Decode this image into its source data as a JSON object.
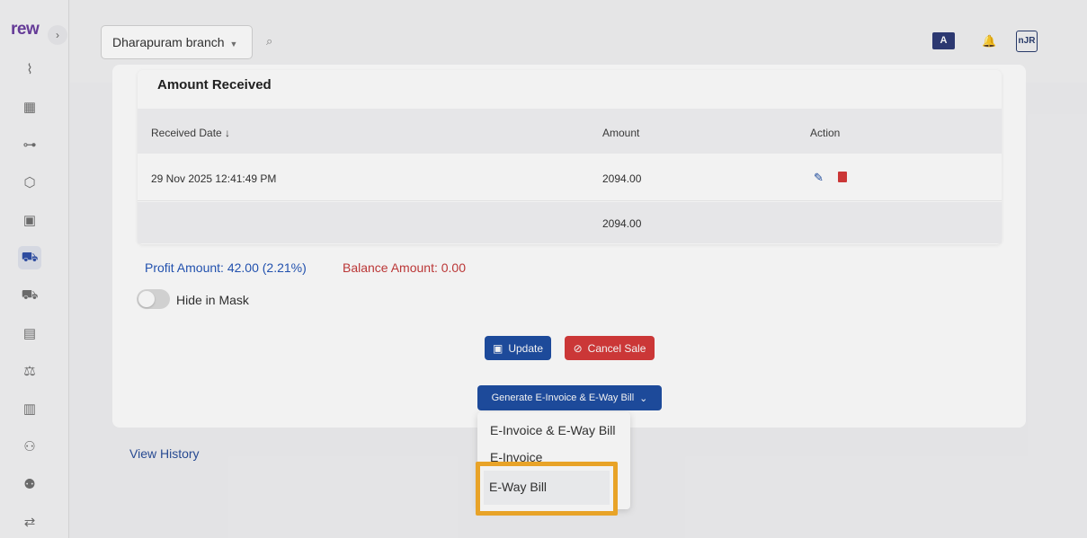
{
  "app": {
    "logo": "rew"
  },
  "sidebar": {
    "collapse_icon": "›",
    "icons": [
      "analytics-icon",
      "store-icon",
      "hierarchy-icon",
      "box-icon",
      "bag-icon",
      "cart-icon",
      "cart-add-icon",
      "document-stack-icon",
      "scale-icon",
      "list-icon",
      "user-edit-icon",
      "users-icon",
      "transfer-icon"
    ]
  },
  "topbar": {
    "branch_label": "Dharapuram branch",
    "language_flag": "A",
    "avatar_text": "nJR"
  },
  "amount_received": {
    "title": "Amount Received",
    "columns": [
      "Received Date ↓",
      "Amount",
      "Action"
    ],
    "rows": [
      {
        "date": "29 Nov 2025 12:41:49 PM",
        "amount": "2094.00"
      }
    ],
    "total": "2094.00"
  },
  "summary": {
    "profit": "Profit Amount: 42.00 (2.21%)",
    "balance": "Balance Amount: 0.00"
  },
  "hide_in_mask": {
    "label": "Hide in Mask"
  },
  "buttons": {
    "update": "Update",
    "cancel": "Cancel Sale",
    "generate": "Generate E-Invoice & E-Way Bill"
  },
  "dropdown": {
    "items": [
      "E-Invoice & E-Way Bill",
      "E-Invoice",
      "E-Way Bill"
    ]
  },
  "links": {
    "view_history": "View History"
  },
  "colors": {
    "primary": "#1f4ea3",
    "danger": "#d63a3a",
    "highlight": "#f5ac2b"
  }
}
